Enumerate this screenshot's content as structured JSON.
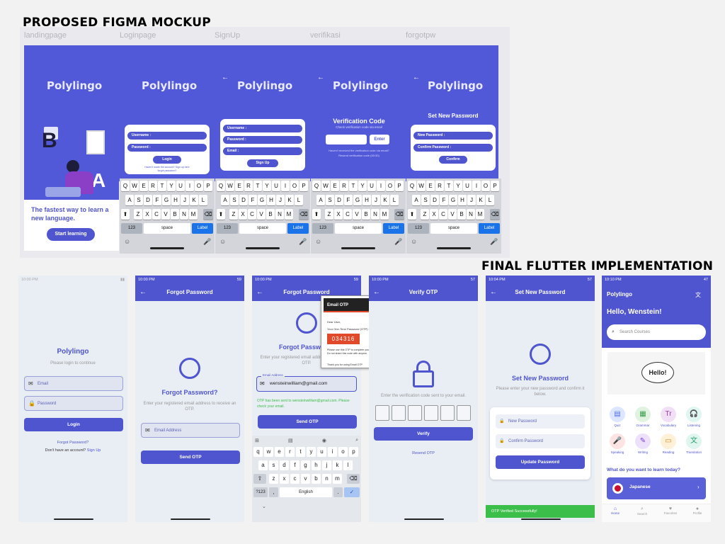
{
  "headings": {
    "figma": "PROPOSED FIGMA MOCKUP",
    "flutter": "FINAL FLUTTER IMPLEMENTATION"
  },
  "figma": {
    "frames": [
      "landingpage",
      "Loginpage",
      "SignUp",
      "verifikasi",
      "forgotpw"
    ],
    "logo": "Polylingo",
    "landing": {
      "tagline": "The fastest way to learn a new language.",
      "cta": "Start learning"
    },
    "login": {
      "username": "Username :",
      "password": "Password :",
      "button": "Login",
      "footer": "Haven't made the account? Sign up here",
      "forgot": "forgot password?"
    },
    "signup": {
      "username": "Username :",
      "password": "Password :",
      "email": "Email :",
      "button": "Sign Up"
    },
    "verify": {
      "title": "Verification Code",
      "subtitle": "Check verification code via email",
      "enter": "Enter",
      "resend_q": "Haven't received the verification code via email?",
      "resend": "Resend verification code (00:30)"
    },
    "setpw": {
      "title": "Set New Password",
      "newpw": "New Password :",
      "confirm": "Confirm Password :",
      "button": "Confirm"
    },
    "keyboard": {
      "row1": [
        "Q",
        "W",
        "E",
        "R",
        "T",
        "Y",
        "U",
        "I",
        "O",
        "P"
      ],
      "row2": [
        "A",
        "S",
        "D",
        "F",
        "G",
        "H",
        "J",
        "K",
        "L"
      ],
      "row3": [
        "Z",
        "X",
        "C",
        "V",
        "B",
        "N",
        "M"
      ],
      "num": "123",
      "space": "space",
      "label": "Label"
    }
  },
  "flutter": {
    "login": {
      "title": "Polylingo",
      "subtitle": "Please login to continue",
      "email": "Email",
      "password": "Password",
      "button": "Login",
      "forgot": "Forgot Password?",
      "noacc": "Don't have an account?",
      "signup": "Sign Up",
      "time": "10:00 PM"
    },
    "forgot": {
      "time": "10:00 PM",
      "battery": "59",
      "appbar": "Forgot Password",
      "title": "Forgot Password?",
      "desc": "Enter your registered email address to receive an OTP.",
      "email": "Email Address",
      "button": "Send OTP"
    },
    "forgot2": {
      "time": "10:00 PM",
      "battery": "59",
      "appbar": "Forgot Password",
      "title": "Forgot Passw",
      "desc": "Enter your registered email address to receive an OTP.",
      "label": "Email Address",
      "email": "wensteinwilliam@gmail.com",
      "success": "OTP has been sent to wensteinwilliam@gmail.com. Please check your email.",
      "button": "Send OTP",
      "email_title": "Email OTP",
      "greet": "Dear User,",
      "otp_line": "Your One-Time Password (OTP) is:",
      "otp": "034316",
      "warn": "Please use this OTP to complete your login process. Do not share this code with anyone.",
      "thanks": "Thank you for using Email OTP.",
      "gkeys1": [
        "q",
        "w",
        "e",
        "r",
        "t",
        "y",
        "u",
        "i",
        "o",
        "p"
      ],
      "gkeys2": [
        "a",
        "s",
        "d",
        "f",
        "g",
        "h",
        "j",
        "k",
        "l"
      ],
      "gkeys3": [
        "z",
        "x",
        "c",
        "v",
        "b",
        "n",
        "m"
      ],
      "num": "?123",
      "lang": "English"
    },
    "verify": {
      "time": "10:00 PM",
      "battery": "57",
      "appbar": "Verify OTP",
      "desc": "Enter the verification code sent to your email.",
      "button": "Verify",
      "resend": "Resend OTP"
    },
    "setpw": {
      "time": "10:04 PM",
      "battery": "57",
      "appbar": "Set New Password",
      "title": "Set New Password",
      "desc": "Please enter your new password and confirm it below.",
      "newpw": "New Password",
      "confirm": "Confirm Password",
      "button": "Update Password",
      "toast": "OTP Verified Successfully!"
    },
    "home": {
      "time": "10:10 PM",
      "battery": "47",
      "brand": "Polylingo",
      "hello": "Hello, Wenstein!",
      "search": "Search Courses",
      "hello_img": "Hello!",
      "tiles": [
        "Quiz",
        "Grammar",
        "Vocabulary",
        "Listening",
        "Speaking",
        "Writing",
        "Reading",
        "Translation"
      ],
      "question": "What do you want to learn today?",
      "course": "Japanese",
      "nav": [
        "Home",
        "Search",
        "Favorites",
        "Profile"
      ]
    }
  },
  "colors": {
    "primary": "#4f55cf",
    "figma_bg": "#5259d8",
    "success": "#3cbf4a",
    "otp_red": "#e04a2a"
  }
}
